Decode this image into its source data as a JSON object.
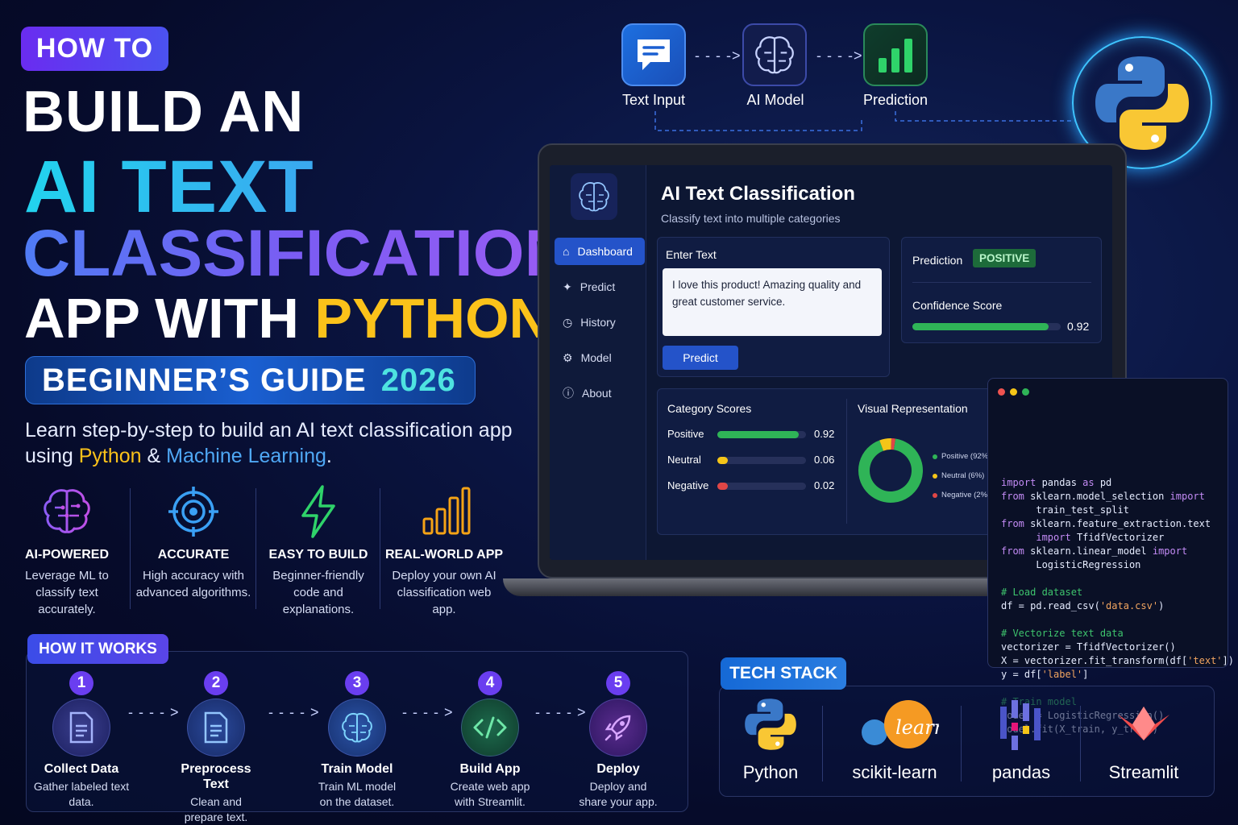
{
  "title": {
    "pill": "HOW TO",
    "line1": "BUILD AN",
    "line2": "AI TEXT",
    "line3": "CLASSIFICATION",
    "line4_a": "APP WITH ",
    "line4_b": "PYTHON",
    "guide": "BEGINNER’S GUIDE",
    "guide_year": "2026"
  },
  "lead": {
    "part1": "Learn step-by-step to build an AI text classification app using ",
    "python": "Python",
    "amp": " & ",
    "ml": "Machine Learning",
    "end": "."
  },
  "features": [
    {
      "title": "AI-POWERED",
      "desc": "Leverage ML to classify text accurately.",
      "icon": "brain-icon"
    },
    {
      "title": "ACCURATE",
      "desc": "High accuracy with advanced algorithms.",
      "icon": "target-icon"
    },
    {
      "title": "EASY TO BUILD",
      "desc": "Beginner-friendly code and explanations.",
      "icon": "lightning-icon"
    },
    {
      "title": "REAL-WORLD APP",
      "desc": "Deploy your own AI classification web app.",
      "icon": "bar-chart-icon"
    }
  ],
  "flow": {
    "items": [
      {
        "label": "Text Input",
        "icon": "chat-icon"
      },
      {
        "label": "AI Model",
        "icon": "brain-icon"
      },
      {
        "label": "Prediction",
        "icon": "bar-chart-icon"
      }
    ]
  },
  "app": {
    "title": "AI Text Classification",
    "subtitle": "Classify text into multiple categories",
    "nav": [
      "Dashboard",
      "Predict",
      "History",
      "Model",
      "About"
    ],
    "enter_text_label": "Enter Text",
    "input_value": "I love this product! Amazing quality and great customer service.",
    "predict_button": "Predict",
    "prediction_label": "Prediction",
    "prediction_value": "POSITIVE",
    "confidence_label": "Confidence Score",
    "confidence_value": "0.92",
    "confidence_fraction": 0.92,
    "category_scores_title": "Category Scores",
    "scores": [
      {
        "label": "Positive",
        "value": "0.92",
        "fraction": 0.92,
        "color": "#2fb457"
      },
      {
        "label": "Neutral",
        "value": "0.06",
        "fraction": 0.06,
        "color": "#f5c518"
      },
      {
        "label": "Negative",
        "value": "0.02",
        "fraction": 0.02,
        "color": "#e04646"
      }
    ],
    "visual_title": "Visual Representation",
    "legend": [
      "Positive (92%)",
      "Neutral (6%)",
      "Negative (2%)"
    ]
  },
  "code": {
    "lines": [
      [
        "k:import",
        " pandas ",
        "k:as",
        " pd"
      ],
      [
        "k:from",
        " sklearn.model_selection ",
        "k:import"
      ],
      [
        "      train_test_split"
      ],
      [
        "k:from",
        " sklearn.feature_extraction.text"
      ],
      [
        "      ",
        "k:import",
        " TfidfVectorizer"
      ],
      [
        "k:from",
        " sklearn.linear_model ",
        "k:import"
      ],
      [
        "      LogisticRegression"
      ],
      [
        ""
      ],
      [
        "cm:# Load dataset"
      ],
      [
        "df = pd.read_csv(",
        "s:'data.csv'",
        ")"
      ],
      [
        ""
      ],
      [
        "cm:# Vectorize text data"
      ],
      [
        "vectorizer = TfidfVectorizer()"
      ],
      [
        "X = vectorizer.fit_transform(df[",
        "s:'text'",
        "])"
      ],
      [
        "y = df[",
        "s:'label'",
        "]"
      ],
      [
        ""
      ],
      [
        "cm:# Train model"
      ],
      [
        "model = LogisticRegression()"
      ],
      [
        "model.fit(X_train, y_train)"
      ]
    ]
  },
  "how_it_works": {
    "title": "HOW IT WORKS",
    "steps": [
      {
        "num": "1",
        "title": "Collect Data",
        "desc": "Gather labeled text data.",
        "icon": "document-icon"
      },
      {
        "num": "2",
        "title": "Preprocess Text",
        "desc": "Clean and prepare text.",
        "icon": "document-icon"
      },
      {
        "num": "3",
        "title": "Train Model",
        "desc": "Train ML model on the dataset.",
        "icon": "brain-icon"
      },
      {
        "num": "4",
        "title": "Build App",
        "desc": "Create web app with Streamlit.",
        "icon": "code-icon"
      },
      {
        "num": "5",
        "title": "Deploy",
        "desc": "Deploy and share your app.",
        "icon": "rocket-icon"
      }
    ]
  },
  "tech_stack": {
    "title": "TECH STACK",
    "items": [
      {
        "label": "Python",
        "icon": "python-logo"
      },
      {
        "label": "scikit-learn",
        "icon": "scikit-learn-logo"
      },
      {
        "label": "pandas",
        "icon": "pandas-logo"
      },
      {
        "label": "Streamlit",
        "icon": "streamlit-logo"
      }
    ]
  },
  "colors": {
    "accent": "#2453c9",
    "python_yellow": "#fbc21a",
    "cyan": "#22d3ee",
    "positive": "#2fb457"
  }
}
